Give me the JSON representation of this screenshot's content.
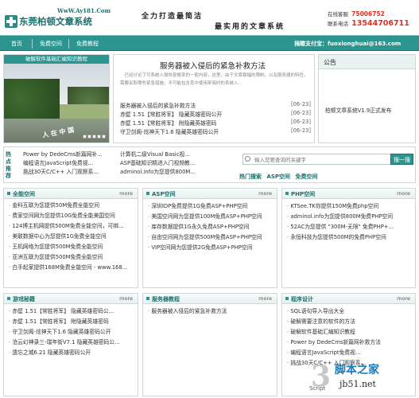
{
  "header": {
    "site_url": "WwW.Ay181.Com",
    "logo_text": "东莞柏顿文章系统",
    "slogan1": "全力打造最简洁",
    "slogan2": "最实用的文章系统",
    "qq_label": "在线客服",
    "qq_value": "75006752",
    "phone_label": "联系电话",
    "phone_value": "13544706711"
  },
  "nav": {
    "items": [
      "首页",
      "免费空间",
      "免费教程"
    ],
    "donate": "捐赠支付宝：fuoxionghuai@163.com"
  },
  "picture": {
    "caption_title": "破解软件基础汇编知识教程",
    "overlay_text": "人 在 中 国",
    "dots": [
      "1",
      "2",
      "3",
      "4",
      "5"
    ]
  },
  "feature": {
    "title": "服务器被入侵后的紧急补救方法",
    "desc": "　已经讨论了可系统入侵恢复概率的一般内容，这里，由于文章篇幅的限制，以及服务器的特性，需要采取哪些紧急措施，不可能包含其中使用来临时的系统入...",
    "items": [
      {
        "text": "服务器被入侵后的紧急补救方法",
        "date": "[06-23]"
      },
      {
        "text": "赤壁 1.51【常胜将军】 隐藏英雄密码公开",
        "date": "[06-23]"
      },
      {
        "text": "赤壁 1.51【常胜将军】 附隐藏英雄密码",
        "date": "[06-23]"
      },
      {
        "text": "守卫剑阁-炫神天下1.6 隐藏英雄密码公开",
        "date": "[06-23]"
      }
    ]
  },
  "notice": {
    "title": "公告",
    "body": "柏顿文章系统V1.9正式发布"
  },
  "hot": {
    "label": "热点推荐",
    "col1": [
      "Power by DedeCms新篇网补...",
      "编程语言JavaScript免费视...",
      "挑战30天C/C++ 入门观察系..."
    ],
    "col2": [
      "计算机二级Visual Basic视...",
      "ASP基础知识精进入门视频教...",
      "adminol.info为您提供800M..."
    ],
    "search_placeholder": "输入您要查询的关键字",
    "search_button": "搜一搜",
    "hot_keys_label": "热门搜索",
    "hot_keys": [
      "ASP空间",
      "免费空间"
    ]
  },
  "panels": [
    {
      "title": "全能空间",
      "more": "more",
      "items": [
        "金科互联为您提供50M免费全能空间",
        "费家空间网为您提供10G免费全能美国空间",
        "124博主机网提供500M免费全能空间，可绑...",
        "美联数据中心为您提供1G免费全能空间",
        "王机网络为您提供500M免费全能空间",
        "亚洲互联为您提供500M免费全能空间",
        "白手起家提供168M免费全能空间 - www.168..."
      ]
    },
    {
      "title": "ASP空间",
      "more": "more",
      "items": [
        "深圳IDP免费提供1G免费ASP+PHP空间",
        "美国空间网为您提供100M免费ASP+PHP空间",
        "库存数据提供1G永久免费ASP+PHP空间",
        "自由空间网为您提供500M免费ASP+PHP空间",
        "VIP空间网为您提供2G免费ASP+PHP空间"
      ]
    },
    {
      "title": "PHP空间",
      "more": "more",
      "items": [
        "KTSee.TK你提供150M免费php空间",
        "adminol.info为您提供800M免费PHP空间",
        "52AC为您提供 \"300M-无限\" 免费PHP+...",
        "永恒科技为您提供500M的免费PHP空间"
      ]
    },
    {
      "title": "游戏秘籍",
      "more": "more",
      "items": [
        "赤壁 1.51【常胜将军】 隐藏英雄密码公...",
        "赤壁 1.51【常胜将军】 附隐藏英雄密码",
        "守卫剑阁-炫神天下1.6 隐藏英雄密码公开",
        "沧云幻神录三-瑞年街V7.1 隐藏英雄密码公...",
        "遗忘之城6.21 隐藏英雄密码公开"
      ]
    },
    {
      "title": "服务器教程",
      "more": "more",
      "items": [
        "服务器被入侵后的紧急补救方法"
      ]
    },
    {
      "title": "程序设计",
      "more": "more",
      "items": [
        "SQL语句导入导出大全",
        "破解需要注意的软件的方法",
        "破解软件基础汇编知识教程",
        "Power by DedeCms新篇网补救方法",
        "编程语言JavaScript免费视...",
        "挑战30天C/C++ 入门观察系..."
      ]
    }
  ],
  "watermark": {
    "big": "3",
    "cn": "脚本之家",
    "url": "jb51.net",
    "script": "Script"
  }
}
